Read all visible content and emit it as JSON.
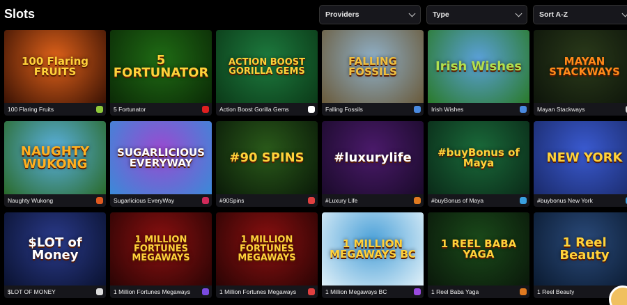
{
  "page": {
    "title": "Slots"
  },
  "filters": {
    "providers": "Providers",
    "type": "Type",
    "sort": "Sort A-Z"
  },
  "games": [
    {
      "name": "100 Flaring Fruits",
      "art_text": "100 Flaring FRUITS",
      "bg": "#e0621a",
      "bg2": "#3a1204",
      "text_color": "#ffd23a",
      "provider_color": "#8fc93a"
    },
    {
      "name": "5 Fortunator",
      "art_text": "5 FORTUNATOR",
      "bg": "#1f6b14",
      "bg2": "#0b2a06",
      "text_color": "#ffd23a",
      "provider_color": "#e02020"
    },
    {
      "name": "Action Boost Gorilla Gems",
      "art_text": "ACTION BOOST GORILLA GEMS",
      "bg": "#1d7a3e",
      "bg2": "#0b3a18",
      "text_color": "#ffd23a",
      "provider_color": "#ffffff"
    },
    {
      "name": "Falling Fossils",
      "art_text": "FALLING FOSSILS",
      "bg": "#8fb0c8",
      "bg2": "#6a5a3a",
      "text_color": "#f0c040",
      "provider_color": "#4a8ae0"
    },
    {
      "name": "Irish Wishes",
      "art_text": "Irish Wishes",
      "bg": "#5aa0d8",
      "bg2": "#2a7a2a",
      "text_color": "#b0e050",
      "provider_color": "#4a8ae0"
    },
    {
      "name": "Mayan Stackways",
      "art_text": "MAYAN STACKWAYS",
      "bg": "#2a3a1a",
      "bg2": "#0d140a",
      "text_color": "#ff8a1a",
      "provider_color": "#dddddd"
    },
    {
      "name": "Naughty Wukong",
      "art_text": "NAUGHTY WUKONG",
      "bg": "#5ab0e0",
      "bg2": "#2a6a2a",
      "text_color": "#ffb020",
      "provider_color": "#e05a20"
    },
    {
      "name": "Sugarlicious EveryWay",
      "art_text": "SUGARLICIOUS EVERYWAY",
      "bg": "#9a4ad0",
      "bg2": "#3a8ad8",
      "text_color": "#ffffff",
      "provider_color": "#d02a5a"
    },
    {
      "name": "#90Spins",
      "art_text": "#90 SPINS",
      "bg": "#2a5a1a",
      "bg2": "#0a1a08",
      "text_color": "#ffd23a",
      "provider_color": "#e04040"
    },
    {
      "name": "#Luxury Life",
      "art_text": "#luxurylife",
      "bg": "#4a1a6a",
      "bg2": "#1a0a2a",
      "text_color": "#ffffff",
      "provider_color": "#e07a20"
    },
    {
      "name": "#buyBonus of Maya",
      "art_text": "#buyBonus of Maya",
      "bg": "#1a6a3a",
      "bg2": "#0a2a18",
      "text_color": "#ffd23a",
      "provider_color": "#3aa0e0"
    },
    {
      "name": "#buybonus New York",
      "art_text": "NEW YORK",
      "bg": "#3a5ad0",
      "bg2": "#1a2a6a",
      "text_color": "#ffd23a",
      "provider_color": "#3aa0e0"
    },
    {
      "name": "$LOT OF MONEY",
      "art_text": "$LOT of Money",
      "bg": "#2a3a8a",
      "bg2": "#0a1230",
      "text_color": "#ffffff",
      "provider_color": "#dddddd"
    },
    {
      "name": "1 Million Fortunes Megaways",
      "art_text": "1 MILLION FORTUNES MEGAWAYS",
      "bg": "#8a1010",
      "bg2": "#2a0404",
      "text_color": "#ffd23a",
      "provider_color": "#7a4ae0"
    },
    {
      "name": "1 Million Fortunes Megaways",
      "art_text": "1 MILLION FORTUNES MEGAWAYS",
      "bg": "#8a1010",
      "bg2": "#2a0404",
      "text_color": "#ffd23a",
      "provider_color": "#e04040"
    },
    {
      "name": "1 Million Megaways BC",
      "art_text": "1 MILLION MEGAWAYS BC",
      "bg": "#4aa0d8",
      "bg2": "#e0f0f8",
      "text_color": "#ffd23a",
      "provider_color": "#9a4ae0"
    },
    {
      "name": "1 Reel Baba Yaga",
      "art_text": "1 REEL BABA YAGA",
      "bg": "#1a4a1a",
      "bg2": "#0a180a",
      "text_color": "#ffd23a",
      "provider_color": "#e07a20"
    },
    {
      "name": "1 Reel Beauty",
      "art_text": "1 Reel Beauty",
      "bg": "#2a4a7a",
      "bg2": "#0a1a30",
      "text_color": "#ffd23a",
      "provider_color": "#e07a20"
    }
  ]
}
